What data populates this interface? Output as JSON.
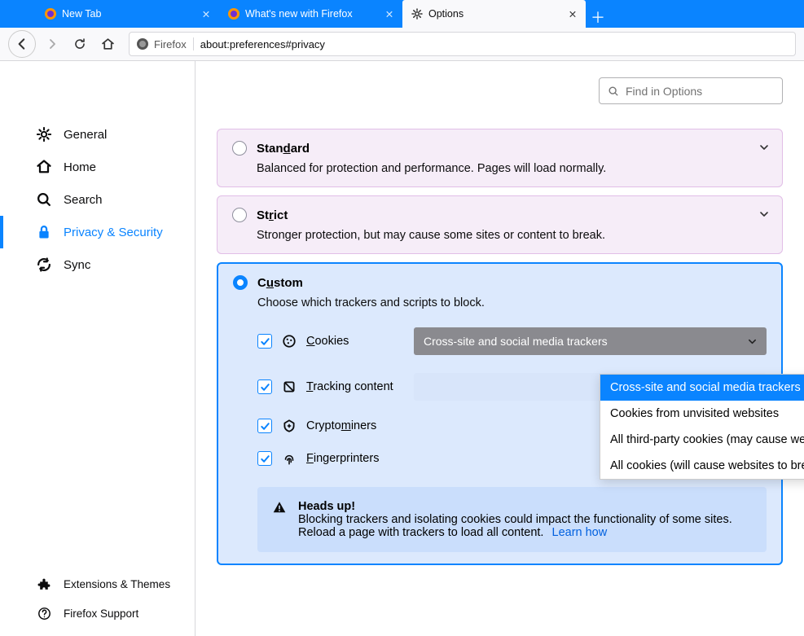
{
  "titlebar": {
    "tabs": [
      {
        "label": "New Tab"
      },
      {
        "label": "What's new with Firefox"
      },
      {
        "label": "Options"
      }
    ]
  },
  "urlbar": {
    "identity": "Firefox",
    "url": "about:preferences#privacy"
  },
  "sidebar": {
    "items": [
      {
        "label": "General"
      },
      {
        "label": "Home"
      },
      {
        "label": "Search"
      },
      {
        "label": "Privacy & Security"
      },
      {
        "label": "Sync"
      }
    ],
    "bottom": [
      {
        "label": "Extensions & Themes"
      },
      {
        "label": "Firefox Support"
      }
    ]
  },
  "search": {
    "placeholder": "Find in Options"
  },
  "panels": {
    "standard": {
      "title": "Standard",
      "desc": "Balanced for protection and performance. Pages will load normally."
    },
    "strict": {
      "title": "Strict",
      "desc": "Stronger protection, but may cause some sites or content to break."
    },
    "custom": {
      "title": "Custom",
      "desc": "Choose which trackers and scripts to block.",
      "options": {
        "cookies": {
          "label": "Cookies",
          "selected": "Cross-site and social media trackers"
        },
        "tracking": {
          "label": "Tracking content"
        },
        "crypto": {
          "label": "Cryptominers"
        },
        "finger": {
          "label": "Fingerprinters"
        }
      },
      "dropdown": [
        "Cross-site and social media trackers",
        "Cookies from unvisited websites",
        "All third-party cookies (may cause websites to break)",
        "All cookies (will cause websites to break)"
      ]
    }
  },
  "callout": {
    "title": "Heads up!",
    "body": "Blocking trackers and isolating cookies could impact the functionality of some sites. Reload a page with trackers to load all content.",
    "link": "Learn how"
  }
}
